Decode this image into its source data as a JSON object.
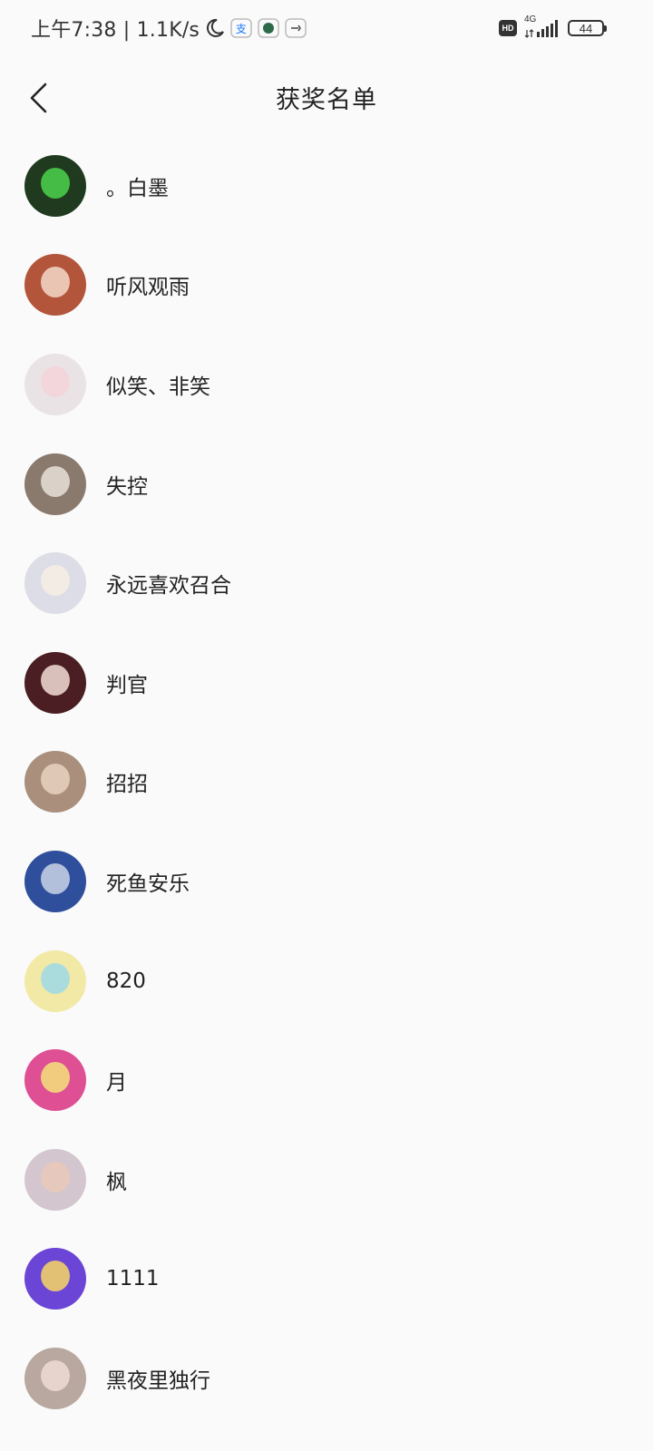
{
  "status_bar": {
    "time": "上午7:38 | 1.1K/s",
    "network_type": "4G",
    "hd_label": "HD",
    "battery": "44"
  },
  "header": {
    "title": "获奖名单",
    "back_icon": "chevron-left-icon"
  },
  "winners": [
    {
      "name": "。白墨",
      "avatar_color": "#1f3a1f",
      "face_color": "#4cd34c"
    },
    {
      "name": "听风观雨",
      "avatar_color": "#b2553a",
      "face_color": "#f3d9c9"
    },
    {
      "name": "似笑、非笑",
      "avatar_color": "#e9e3e6",
      "face_color": "#f3d3d8"
    },
    {
      "name": "失控",
      "avatar_color": "#8a7a6e",
      "face_color": "#e7e0d8"
    },
    {
      "name": "永远喜欢召合",
      "avatar_color": "#dcdde6",
      "face_color": "#f6efe3"
    },
    {
      "name": "判官",
      "avatar_color": "#4a1e22",
      "face_color": "#f3ddd6"
    },
    {
      "name": "招招",
      "avatar_color": "#a98f7c",
      "face_color": "#e9d2c1"
    },
    {
      "name": "死鱼安乐",
      "avatar_color": "#2f4f9c",
      "face_color": "#c9d3e6"
    },
    {
      "name": "820",
      "avatar_color": "#f2e9a6",
      "face_color": "#9fd9e6"
    },
    {
      "name": "月",
      "avatar_color": "#de4f94",
      "face_color": "#f5e27a"
    },
    {
      "name": "枫",
      "avatar_color": "#d4c6cf",
      "face_color": "#e9c9b9"
    },
    {
      "name": "1111",
      "avatar_color": "#6a45d6",
      "face_color": "#f7d764"
    },
    {
      "name": "黑夜里独行",
      "avatar_color": "#b8a89f",
      "face_color": "#efdcd3"
    }
  ]
}
